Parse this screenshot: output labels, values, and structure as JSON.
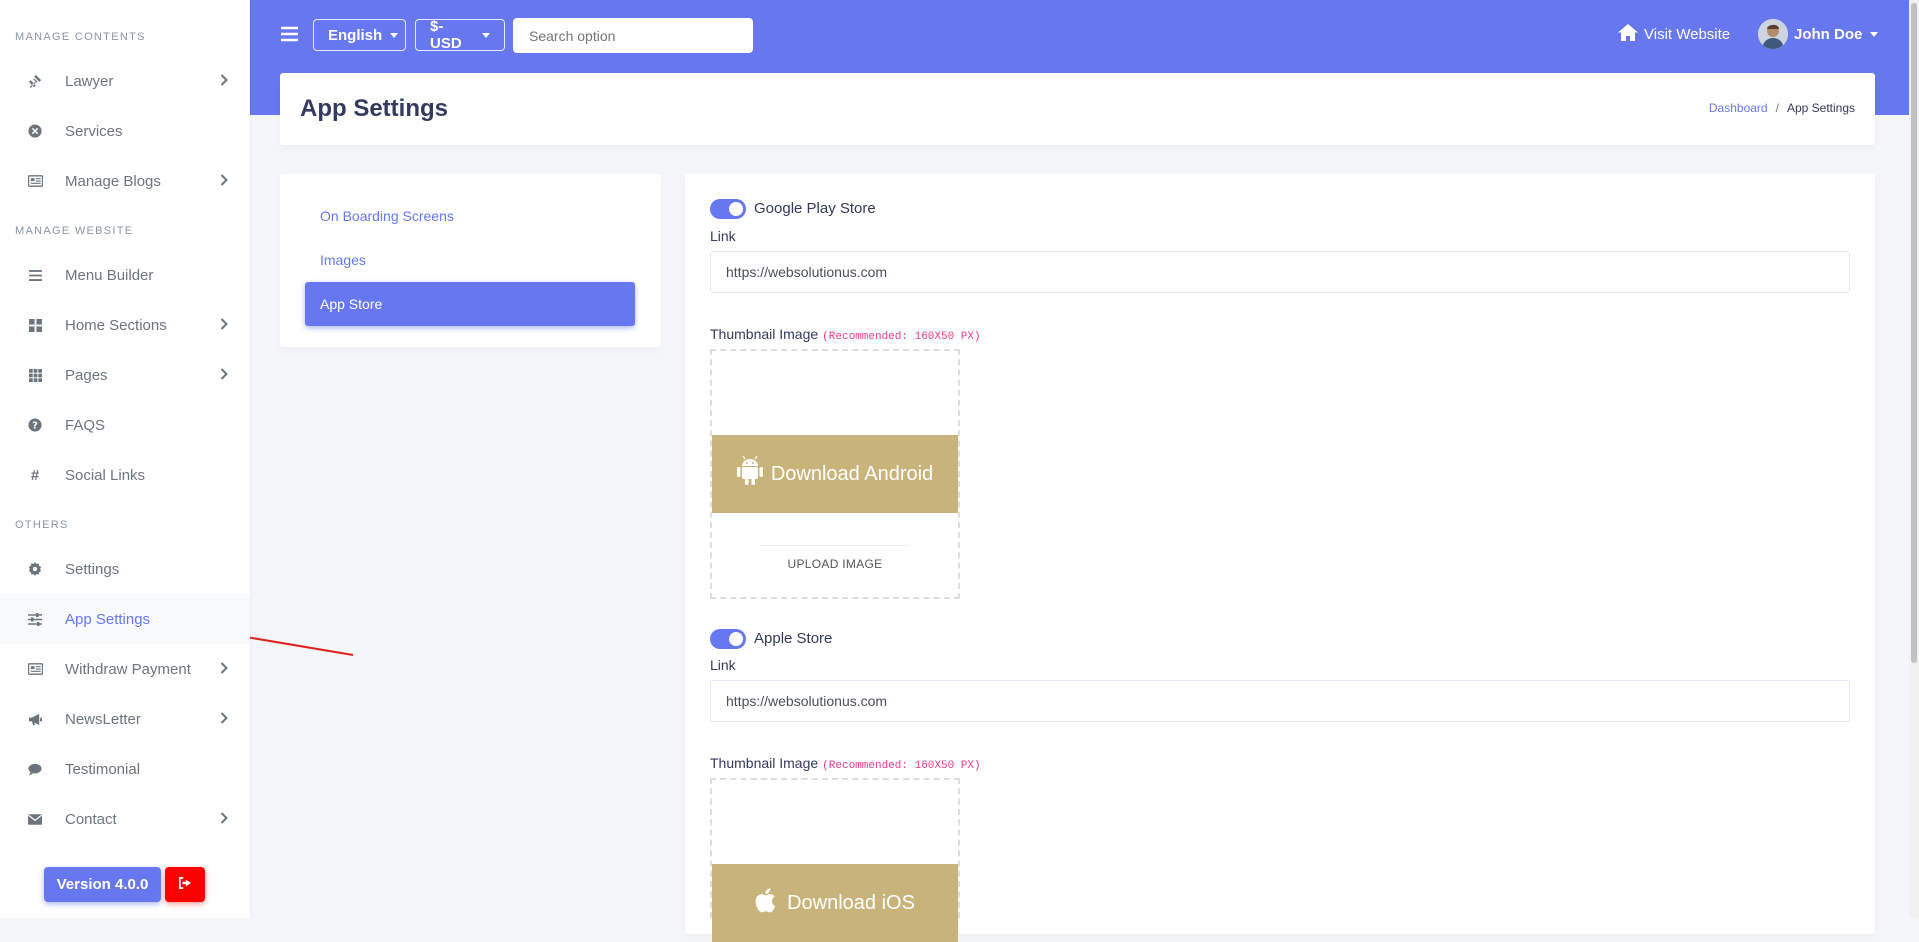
{
  "sidebar": {
    "sections": {
      "manage_contents": "MANAGE CONTENTS",
      "manage_website": "MANAGE WEBSITE",
      "others": "OTHERS"
    },
    "items": [
      {
        "label": "Lawyer",
        "icon": "gavel-icon",
        "chevron": true
      },
      {
        "label": "Services",
        "icon": "times-circle-icon",
        "chevron": false
      },
      {
        "label": "Manage Blogs",
        "icon": "newspaper-icon",
        "chevron": true
      },
      {
        "label": "Menu Builder",
        "icon": "bars-icon",
        "chevron": false
      },
      {
        "label": "Home Sections",
        "icon": "windows-icon",
        "chevron": true
      },
      {
        "label": "Pages",
        "icon": "grid-icon",
        "chevron": true
      },
      {
        "label": "FAQS",
        "icon": "question-circle-icon",
        "chevron": false
      },
      {
        "label": "Social Links",
        "icon": "hashtag-icon",
        "chevron": false
      },
      {
        "label": "Settings",
        "icon": "cog-icon",
        "chevron": false
      },
      {
        "label": "App Settings",
        "icon": "sliders-icon",
        "chevron": false,
        "active": true
      },
      {
        "label": "Withdraw Payment",
        "icon": "newspaper-icon",
        "chevron": true
      },
      {
        "label": "NewsLetter",
        "icon": "bullhorn-icon",
        "chevron": true
      },
      {
        "label": "Testimonial",
        "icon": "comment-icon",
        "chevron": false
      },
      {
        "label": "Contact",
        "icon": "envelope-icon",
        "chevron": true
      }
    ],
    "version_label": "Version 4.0.0"
  },
  "topbar": {
    "language": "English",
    "currency": "$-USD",
    "search_placeholder": "Search option",
    "visit_website": "Visit Website",
    "user_name": "John Doe"
  },
  "header": {
    "title": "App Settings",
    "breadcrumb_home": "Dashboard",
    "breadcrumb_sep": "/",
    "breadcrumb_current": "App Settings"
  },
  "tabs": [
    {
      "label": "On Boarding Screens",
      "active": false
    },
    {
      "label": "Images",
      "active": false
    },
    {
      "label": "App Store",
      "active": true
    }
  ],
  "google_play": {
    "toggle_label": "Google Play Store",
    "enabled": true,
    "link_label": "Link",
    "link_value": "https://websolutionus.com",
    "thumb_label": "Thumbnail Image",
    "thumb_rec": "(Recommended: 160X50 PX)",
    "thumb_text": "Download Android",
    "upload_label": "UPLOAD IMAGE"
  },
  "apple_store": {
    "toggle_label": "Apple Store",
    "enabled": true,
    "link_label": "Link",
    "link_value": "https://websolutionus.com",
    "thumb_label": "Thumbnail Image",
    "thumb_rec": "(Recommended: 160X50 PX)",
    "thumb_text": "Download iOS"
  },
  "colors": {
    "primary": "#6777ef",
    "danger": "#fc0000",
    "thumb_bg": "#c8b47a"
  }
}
